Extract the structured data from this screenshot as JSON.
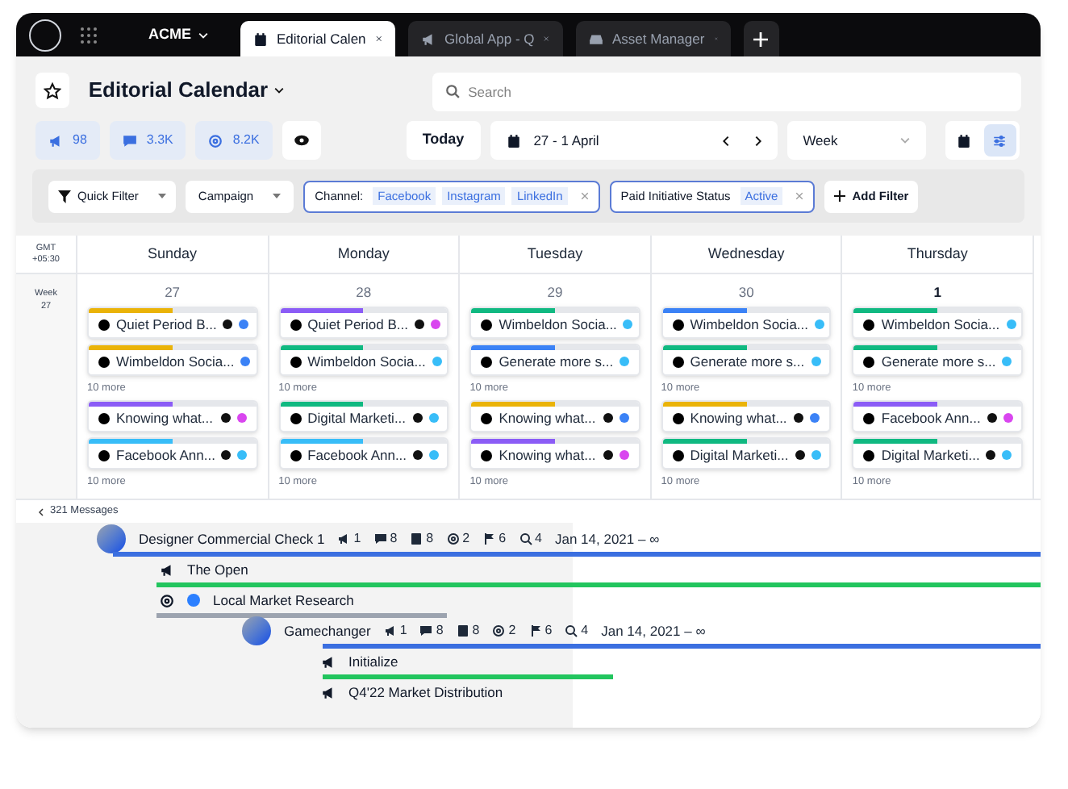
{
  "topbar": {
    "brand": "ACME",
    "tabs": [
      {
        "label": "Editorial Calen",
        "selected": true,
        "kind": "calendar"
      },
      {
        "label": "Global App - Q",
        "selected": false,
        "kind": "megaphone"
      },
      {
        "label": "Asset Manager",
        "selected": false,
        "kind": "inbox"
      }
    ]
  },
  "header": {
    "title": "Editorial Calendar",
    "search": {
      "placeholder": "Search"
    }
  },
  "toolbar": {
    "stats": [
      {
        "kind": "megaphone",
        "value": "98"
      },
      {
        "kind": "chat",
        "value": "3.3K"
      },
      {
        "kind": "target",
        "value": "8.2K"
      }
    ],
    "today": "Today",
    "range": "27 - 1 April",
    "period": "Week",
    "views": [
      {
        "kind": "calendar",
        "selected": false
      },
      {
        "kind": "list",
        "selected": true
      }
    ]
  },
  "filters": {
    "quick": "Quick Filter",
    "campaign": "Campaign",
    "chips": [
      {
        "label": "Channel:",
        "values": [
          "Facebook",
          "Instagram",
          "LinkedIn"
        ]
      },
      {
        "label": "Paid Initiative Status",
        "values": [
          "Active"
        ]
      }
    ],
    "add": "Add Filter"
  },
  "calendar": {
    "timezone": [
      "GMT",
      "+05:30"
    ],
    "week": [
      "Week",
      "27"
    ],
    "days": [
      {
        "name": "Sunday",
        "date": "27",
        "today": false,
        "groups": [
          {
            "cards": [
              {
                "title": "Quiet Period B...",
                "color": "#eab308",
                "badges": [
                  {
                    "color": "#111111"
                  },
                  {
                    "color": "#3b82f6"
                  }
                ]
              },
              {
                "title": "Wimbeldon Socia...",
                "color": "#eab308",
                "badges": [
                  {
                    "color": "#3b82f6"
                  }
                ]
              }
            ],
            "more": "10 more"
          },
          {
            "cards": [
              {
                "title": "Knowing what...",
                "color": "#8b5cf6",
                "badges": [
                  {
                    "color": "#111111"
                  },
                  {
                    "color": "#d946ef"
                  }
                ]
              },
              {
                "title": "Facebook Ann...",
                "color": "#38bdf8",
                "badges": [
                  {
                    "color": "#111111"
                  },
                  {
                    "color": "#38bdf8"
                  }
                ]
              }
            ],
            "more": "10 more"
          }
        ]
      },
      {
        "name": "Monday",
        "date": "28",
        "today": false,
        "groups": [
          {
            "cards": [
              {
                "title": "Quiet Period B...",
                "color": "#8b5cf6",
                "badges": [
                  {
                    "color": "#111111"
                  },
                  {
                    "color": "#d946ef"
                  }
                ]
              },
              {
                "title": "Wimbeldon Socia...",
                "color": "#10b981",
                "badges": [
                  {
                    "color": "#38bdf8"
                  }
                ]
              }
            ],
            "more": "10 more"
          },
          {
            "cards": [
              {
                "title": "Digital Marketi...",
                "color": "#10b981",
                "badges": [
                  {
                    "color": "#111111"
                  },
                  {
                    "color": "#38bdf8"
                  }
                ]
              },
              {
                "title": "Facebook Ann...",
                "color": "#38bdf8",
                "badges": [
                  {
                    "color": "#111111"
                  },
                  {
                    "color": "#38bdf8"
                  }
                ]
              }
            ],
            "more": "10 more"
          }
        ]
      },
      {
        "name": "Tuesday",
        "date": "29",
        "today": false,
        "groups": [
          {
            "cards": [
              {
                "title": "Wimbeldon Socia...",
                "color": "#10b981",
                "badges": [
                  {
                    "color": "#38bdf8"
                  }
                ]
              },
              {
                "title": "Generate more s...",
                "color": "#3b82f6",
                "badges": [
                  {
                    "color": "#38bdf8"
                  }
                ]
              }
            ],
            "more": "10 more"
          },
          {
            "cards": [
              {
                "title": "Knowing what...",
                "color": "#eab308",
                "badges": [
                  {
                    "color": "#111111"
                  },
                  {
                    "color": "#3b82f6"
                  }
                ]
              },
              {
                "title": "Knowing what...",
                "color": "#8b5cf6",
                "badges": [
                  {
                    "color": "#111111"
                  },
                  {
                    "color": "#d946ef"
                  }
                ]
              }
            ],
            "more": "10 more"
          }
        ]
      },
      {
        "name": "Wednesday",
        "date": "30",
        "today": false,
        "groups": [
          {
            "cards": [
              {
                "title": "Wimbeldon Socia...",
                "color": "#3b82f6",
                "badges": [
                  {
                    "color": "#38bdf8"
                  }
                ]
              },
              {
                "title": "Generate more s...",
                "color": "#10b981",
                "badges": [
                  {
                    "color": "#38bdf8"
                  }
                ]
              }
            ],
            "more": "10 more"
          },
          {
            "cards": [
              {
                "title": "Knowing what...",
                "color": "#eab308",
                "badges": [
                  {
                    "color": "#111111"
                  },
                  {
                    "color": "#3b82f6"
                  }
                ]
              },
              {
                "title": "Digital Marketi...",
                "color": "#10b981",
                "badges": [
                  {
                    "color": "#111111"
                  },
                  {
                    "color": "#38bdf8"
                  }
                ]
              }
            ],
            "more": "10 more"
          }
        ]
      },
      {
        "name": "Thursday",
        "date": "1",
        "today": true,
        "groups": [
          {
            "cards": [
              {
                "title": "Wimbeldon Socia...",
                "color": "#10b981",
                "badges": [
                  {
                    "color": "#38bdf8"
                  }
                ]
              },
              {
                "title": "Generate more s...",
                "color": "#10b981",
                "badges": [
                  {
                    "color": "#38bdf8"
                  }
                ]
              }
            ],
            "more": "10 more"
          },
          {
            "cards": [
              {
                "title": "Facebook Ann...",
                "color": "#8b5cf6",
                "badges": [
                  {
                    "color": "#111111"
                  },
                  {
                    "color": "#d946ef"
                  }
                ]
              },
              {
                "title": "Digital Marketi...",
                "color": "#10b981",
                "badges": [
                  {
                    "color": "#111111"
                  },
                  {
                    "color": "#38bdf8"
                  }
                ]
              }
            ],
            "more": "10 more"
          }
        ]
      }
    ]
  },
  "timeline": {
    "back": "321 Messages",
    "items": [
      {
        "title": "Designer Commercial Check 1",
        "date": "Jan 14, 2021 – ∞",
        "color": "#3b6fe0",
        "open_ended": true,
        "stats": [
          {
            "kind": "megaphone",
            "value": "1"
          },
          {
            "kind": "chat",
            "value": "8"
          },
          {
            "kind": "doc",
            "value": "8"
          },
          {
            "kind": "target",
            "value": "2"
          },
          {
            "kind": "flag",
            "value": "6"
          },
          {
            "kind": "search",
            "value": "4"
          }
        ],
        "children": [
          {
            "title": "The Open",
            "kind": "megaphone",
            "color": "#22c55e",
            "open_ended": true
          },
          {
            "title": "Local Market Research",
            "kind": "target",
            "info": true,
            "color": "#9ca3af",
            "open_ended": false
          },
          {
            "title": "Gamechanger",
            "date": "Jan 14, 2021 – ∞",
            "color": "#3b6fe0",
            "open_ended": true,
            "stats": [
              {
                "kind": "megaphone",
                "value": "1"
              },
              {
                "kind": "chat",
                "value": "8"
              },
              {
                "kind": "doc",
                "value": "8"
              },
              {
                "kind": "target",
                "value": "2"
              },
              {
                "kind": "flag",
                "value": "6"
              },
              {
                "kind": "search",
                "value": "4"
              }
            ],
            "children": [
              {
                "title": "Initialize",
                "kind": "megaphone",
                "color": "#22c55e",
                "open_ended": false
              },
              {
                "title": "Q4'22 Market Distribution",
                "kind": "megaphone"
              }
            ]
          }
        ]
      }
    ]
  }
}
